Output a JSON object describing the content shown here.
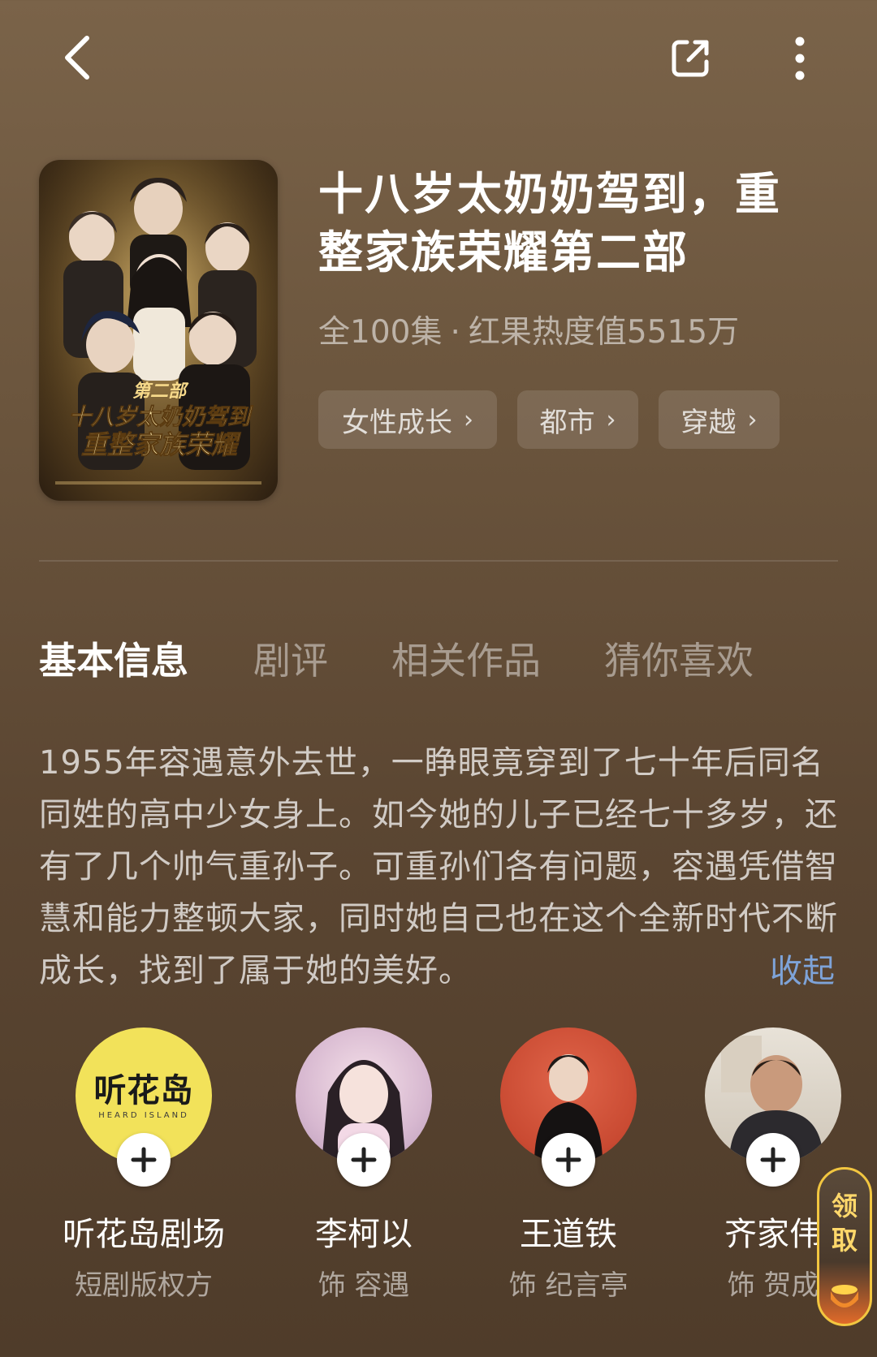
{
  "title": "十八岁太奶奶驾到，重整家族荣耀第二部",
  "meta": {
    "episodes": "全100集",
    "heat": "红果热度值5515万"
  },
  "tags": [
    {
      "label": "女性成长"
    },
    {
      "label": "都市"
    },
    {
      "label": "穿越"
    }
  ],
  "tabs": [
    {
      "label": "基本信息",
      "active": true
    },
    {
      "label": "剧评",
      "active": false
    },
    {
      "label": "相关作品",
      "active": false
    },
    {
      "label": "猜你喜欢",
      "active": false
    }
  ],
  "synopsis": "1955年容遇意外去世，一睁眼竟穿到了七十年后同名同姓的高中少女身上。如今她的儿子已经七十多岁，还有了几个帅气重孙子。可重孙们各有问题，容遇凭借智慧和能力整顿大家，同时她自己也在这个全新时代不断成长，找到了属于她的美好。",
  "collapse_label": "收起",
  "cast": [
    {
      "name": "听花岛剧场",
      "role": "短剧版权方",
      "logo_text": "听花岛",
      "logo_subtext": "HEARD ISLAND"
    },
    {
      "name": "李柯以",
      "role": "饰 容遇"
    },
    {
      "name": "王道铁",
      "role": "饰 纪言亭"
    },
    {
      "name": "齐家伟",
      "role": "饰 贺成"
    }
  ],
  "poster": {
    "line1": "第二部",
    "line2": "十八岁太奶奶驾到",
    "line3": "重整家族荣耀"
  },
  "reward": {
    "label": "领取"
  },
  "icons": {
    "back": "back-chevron-icon",
    "share": "share-icon",
    "more": "more-vertical-icon",
    "plus": "plus-icon"
  },
  "colors": {
    "accent_link": "#7ea3d8",
    "logo_yellow": "#f2e25a"
  }
}
